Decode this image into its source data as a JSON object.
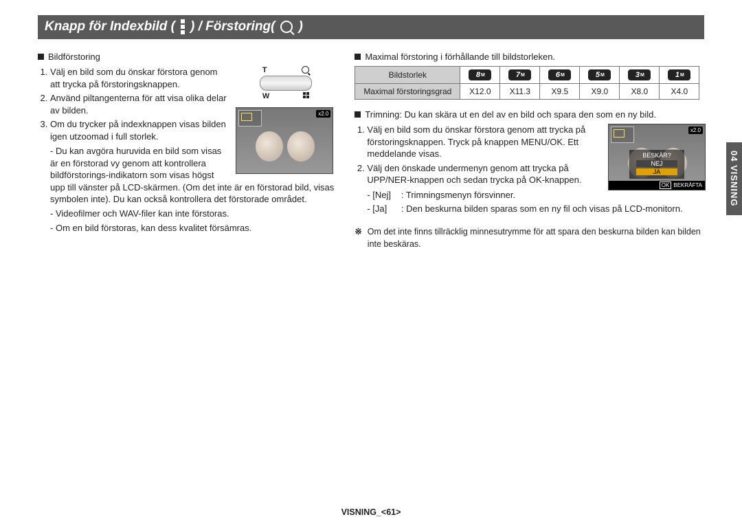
{
  "header": {
    "title_prefix": "Knapp för Indexbild (",
    "title_mid": ") / Förstoring(",
    "title_end": ")"
  },
  "sidebar": {
    "label": "04 VISNING"
  },
  "footer": {
    "text": "VISNING_<61>"
  },
  "left": {
    "section_title": "Bildförstoring",
    "steps": [
      "Välj en bild som du önskar förstora genom att trycka på förstoringsknappen.",
      "Använd piltangenterna för att visa olika delar av bilden.",
      "Om du trycker på indexknappen visas bilden igen utzoomad i full storlek."
    ],
    "notes": [
      "Du kan avgöra huruvida en bild som visas är en förstorad vy genom att kontrollera bildförstorings-indikatorn som visas högst upp till vänster på LCD-skärmen. (Om det inte är en förstorad bild, visas symbolen inte). Du kan också kontrollera det förstorade området.",
      "Videofilmer och WAV-filer kan inte förstoras.",
      "Om en bild förstoras, kan dess kvalitet försämras."
    ],
    "toggle": {
      "T": "T",
      "W": "W"
    },
    "lcd1": {
      "badge": "x2.0"
    }
  },
  "right": {
    "section1_title": "Maximal förstoring i förhållande till bildstorleken.",
    "table": {
      "row1_label": "Bildstorlek",
      "row2_label": "Maximal förstoringsgrad",
      "sizes": [
        "8",
        "7",
        "6",
        "5",
        "3",
        "1"
      ],
      "zoom": [
        "X12.0",
        "X11.3",
        "X9.5",
        "X9.0",
        "X8.0",
        "X4.0"
      ]
    },
    "section2_title": "Trimning: Du kan skära ut en del av en bild och spara den som en ny bild.",
    "steps": [
      "Välj en bild som du önskar förstora genom att trycka på förstoringsknappen. Tryck på knappen MENU/OK. Ett meddelande visas.",
      "Välj den önskade undermenyn genom att trycka på UPP/NER-knappen och sedan trycka på OK-knappen."
    ],
    "results": {
      "nej_key": "[Nej]",
      "nej_val": ": Trimningsmenyn försvinner.",
      "ja_key": "[Ja]",
      "ja_val": ": Den beskurna bilden sparas som en ny fil och visas på LCD-monitorn."
    },
    "note_prefix": "※",
    "note_text": "Om det inte finns tillräcklig minnesutrymme för att spara den beskurna bilden kan bilden inte beskäras.",
    "lcd2": {
      "badge": "x2.0",
      "dialog_title": "BESKÄR?",
      "opt_no": "NEJ",
      "opt_yes": "JA",
      "ok": "OK",
      "confirm": "BEKRÄFTA"
    }
  }
}
